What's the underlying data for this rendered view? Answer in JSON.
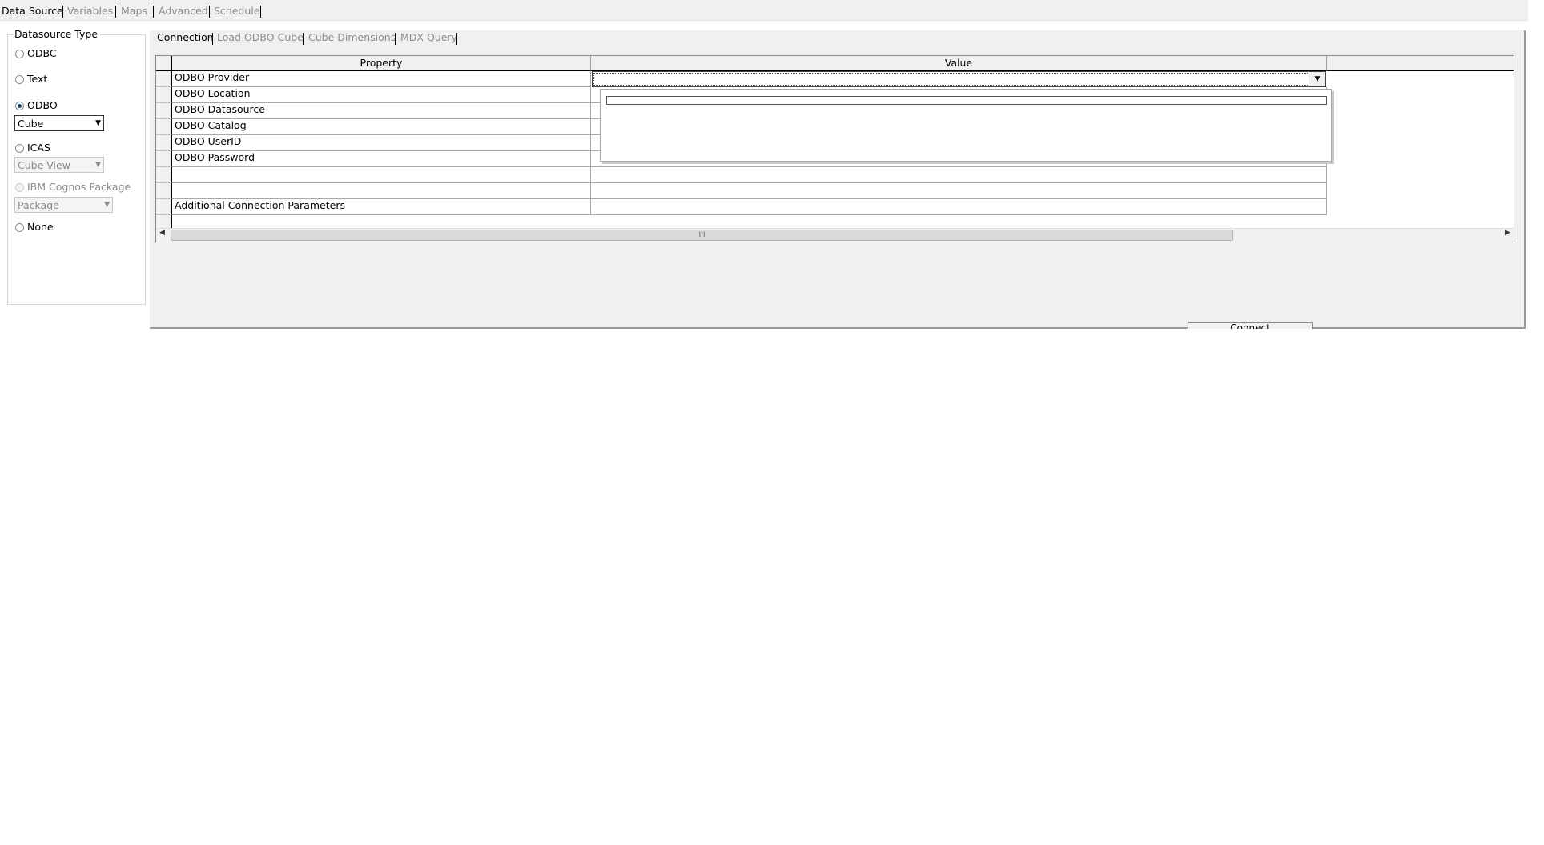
{
  "top_tabs": [
    "Data Source",
    "Variables",
    "Maps",
    "Advanced",
    "Schedule"
  ],
  "datasource": {
    "legend": "Datasource Type",
    "odbc": "ODBC",
    "text": "Text",
    "odbo": "ODBO",
    "odbo_combo": "Cube",
    "icas": "ICAS",
    "icas_combo": "Cube View",
    "cognos": "IBM Cognos Package",
    "cognos_combo": "Package",
    "none": "None"
  },
  "inner_tabs": [
    "Connection",
    "Load ODBO Cube",
    "Cube Dimensions",
    "MDX Query"
  ],
  "grid": {
    "col_property": "Property",
    "col_value": "Value",
    "rows": [
      "ODBO Provider",
      "ODBO Location",
      "ODBO Datasource",
      "ODBO Catalog",
      "ODBO UserID",
      "ODBO Password",
      "",
      "",
      "Additional Connection Parameters"
    ],
    "scroll_grip": "III"
  },
  "connect_label": "Connect",
  "icons": {
    "dropdown": "chevron-down-icon",
    "scroll_left": "arrow-left-icon",
    "scroll_right": "arrow-right-icon"
  }
}
